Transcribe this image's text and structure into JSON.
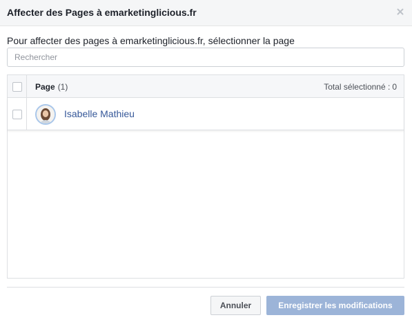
{
  "dialog": {
    "title": "Affecter des Pages à emarketinglicious.fr",
    "close_icon": "close-icon"
  },
  "intro_text": "Pour affecter des pages à emarketinglicious.fr, sélectionner la page",
  "search": {
    "placeholder": "Rechercher",
    "value": ""
  },
  "table": {
    "header": {
      "page_label": "Page",
      "page_count": "(1)",
      "total_label": "Total sélectionné :",
      "total_value": "0"
    },
    "rows": [
      {
        "name": "Isabelle Mathieu",
        "checked": false
      }
    ]
  },
  "footer": {
    "cancel_label": "Annuler",
    "save_label": "Enregistrer les modifications"
  },
  "colors": {
    "link": "#365899",
    "save_button_disabled": "#9cb4d8",
    "header_bg": "#f5f6f7"
  }
}
